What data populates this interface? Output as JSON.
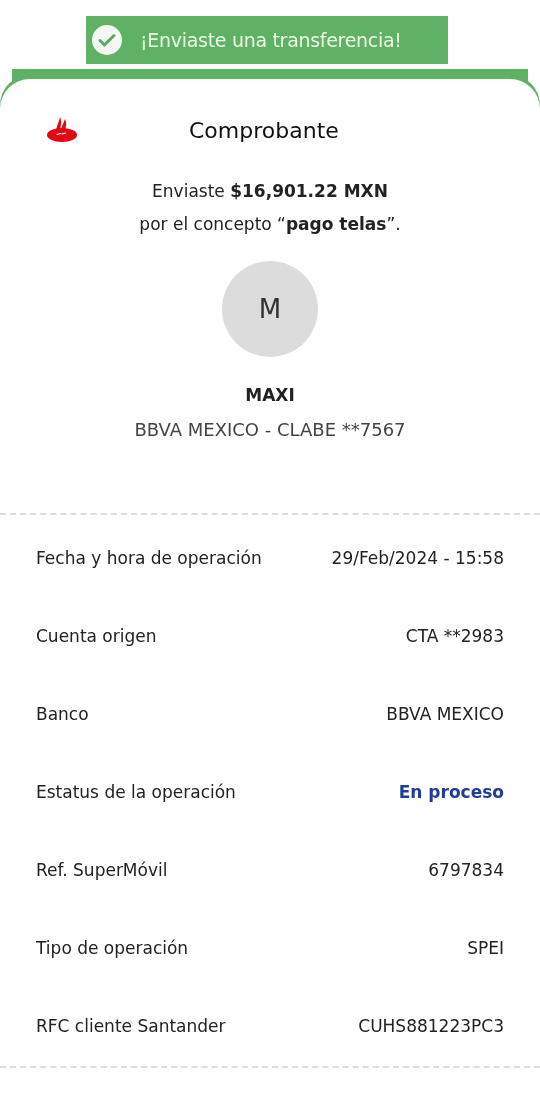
{
  "banner": {
    "message": "¡Enviaste una transferencia!"
  },
  "header": {
    "title": "Comprobante"
  },
  "summary": {
    "line_1": "Enviaste **$16,901.22 MXN**",
    "line_2": "por el concepto “**pago telas**”."
  },
  "recipient": {
    "initial": "M",
    "name": "MAXI",
    "account": "BBVA MEXICO - CLABE **7567"
  },
  "details": [
    {
      "label": "Fecha y hora de operación",
      "value": "29/Feb/2024 - 15:58",
      "kind": "plain"
    },
    {
      "label": "Cuenta origen",
      "value": "CTA **2983",
      "kind": "plain"
    },
    {
      "label": "Banco",
      "value": "BBVA MEXICO",
      "kind": "plain"
    },
    {
      "label": "Estatus de la operación",
      "value": "En proceso",
      "kind": "status"
    },
    {
      "label": "Ref. SuperMóvil",
      "value": "6797834",
      "kind": "plain"
    },
    {
      "label": "Tipo de operación",
      "value": "SPEI",
      "kind": "plain"
    },
    {
      "label": "RFC cliente Santander",
      "value": "CUHS881223PC3",
      "kind": "plain"
    }
  ]
}
